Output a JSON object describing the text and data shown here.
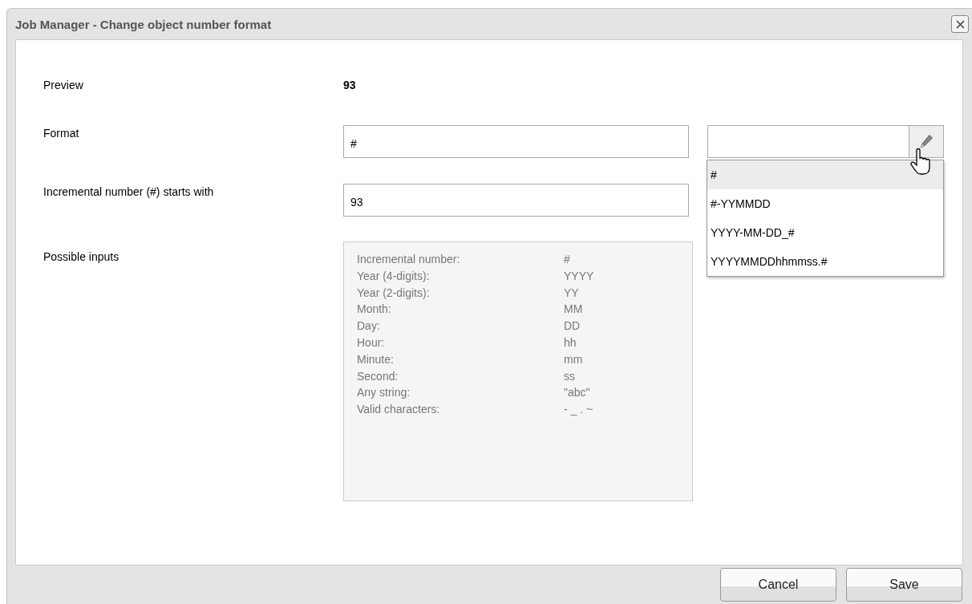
{
  "window": {
    "title": "Job Manager - Change object number format"
  },
  "preview": {
    "label": "Preview",
    "value": "93"
  },
  "format": {
    "label": "Format",
    "value": "#"
  },
  "template_picker": {
    "options": [
      {
        "label": "#",
        "selected": true
      },
      {
        "label": "#-YYMMDD",
        "selected": false
      },
      {
        "label": "YYYY-MM-DD_#",
        "selected": false
      },
      {
        "label": "YYYYMMDDhhmmss.#",
        "selected": false
      }
    ]
  },
  "start_number": {
    "label": "Incremental number (#) starts with",
    "value": "93"
  },
  "possible_inputs": {
    "label": "Possible inputs",
    "rows": [
      {
        "name": "Incremental number:",
        "code": "#"
      },
      {
        "name": "Year (4-digits):",
        "code": "YYYY"
      },
      {
        "name": "Year (2-digits):",
        "code": "YY"
      },
      {
        "name": "Month:",
        "code": "MM"
      },
      {
        "name": "Day:",
        "code": "DD"
      },
      {
        "name": "Hour:",
        "code": "hh"
      },
      {
        "name": "Minute:",
        "code": "mm"
      },
      {
        "name": "Second:",
        "code": "ss"
      },
      {
        "name": "Any string:",
        "code": "\"abc\""
      },
      {
        "name": "Valid characters:",
        "code": "- _ . ~"
      }
    ]
  },
  "buttons": [
    "Cancel",
    "Save"
  ]
}
